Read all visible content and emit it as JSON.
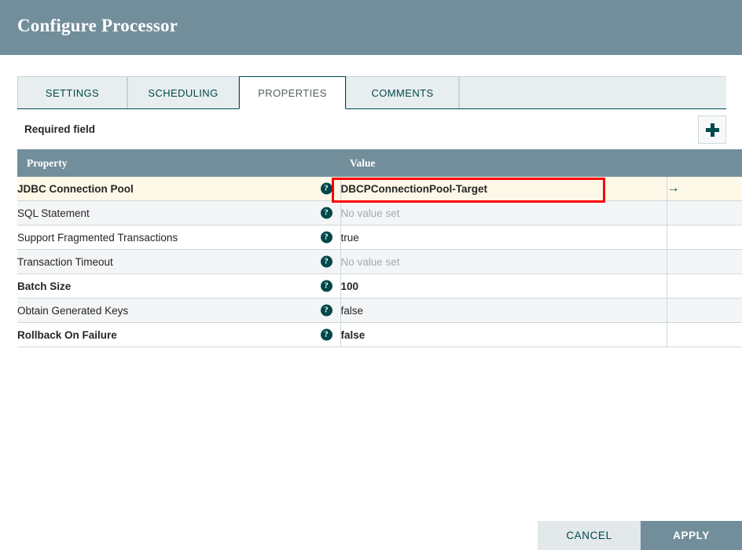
{
  "dialog": {
    "title": "Configure Processor"
  },
  "tabs": [
    {
      "label": "SETTINGS",
      "active": false
    },
    {
      "label": "SCHEDULING",
      "active": false
    },
    {
      "label": "PROPERTIES",
      "active": true
    },
    {
      "label": "COMMENTS",
      "active": false
    }
  ],
  "toolbar": {
    "required_field_label": "Required field",
    "add_button_icon": "plus-icon"
  },
  "table": {
    "columns": [
      "Property",
      "Value",
      ""
    ],
    "rows": [
      {
        "property": "JDBC Connection Pool",
        "value": "DBCPConnectionPool-Target",
        "required": true,
        "unset": false,
        "highlighted": true,
        "go_to_icon": "arrow-right-icon",
        "help_icon": "help-circle-icon"
      },
      {
        "property": "SQL Statement",
        "value": "No value set",
        "required": false,
        "unset": true,
        "highlighted": false,
        "go_to_icon": "",
        "help_icon": "help-circle-icon"
      },
      {
        "property": "Support Fragmented Transactions",
        "value": "true",
        "required": false,
        "unset": false,
        "highlighted": false,
        "go_to_icon": "",
        "help_icon": "help-circle-icon"
      },
      {
        "property": "Transaction Timeout",
        "value": "No value set",
        "required": false,
        "unset": true,
        "highlighted": false,
        "go_to_icon": "",
        "help_icon": "help-circle-icon"
      },
      {
        "property": "Batch Size",
        "value": "100",
        "required": true,
        "unset": false,
        "highlighted": false,
        "go_to_icon": "",
        "help_icon": "help-circle-icon"
      },
      {
        "property": "Obtain Generated Keys",
        "value": "false",
        "required": false,
        "unset": false,
        "highlighted": false,
        "go_to_icon": "",
        "help_icon": "help-circle-icon"
      },
      {
        "property": "Rollback On Failure",
        "value": "false",
        "required": true,
        "unset": false,
        "highlighted": false,
        "go_to_icon": "",
        "help_icon": "help-circle-icon"
      }
    ]
  },
  "footer": {
    "cancel_label": "CANCEL",
    "apply_label": "APPLY"
  },
  "annotation": {
    "highlight_color": "#ff0000",
    "target": "DBCPConnectionPool-Target"
  },
  "colors": {
    "header_bg": "#728e9b",
    "accent_teal": "#004849",
    "highlight_row": "#fdf8e7",
    "stripe": "#f3f5f7"
  }
}
